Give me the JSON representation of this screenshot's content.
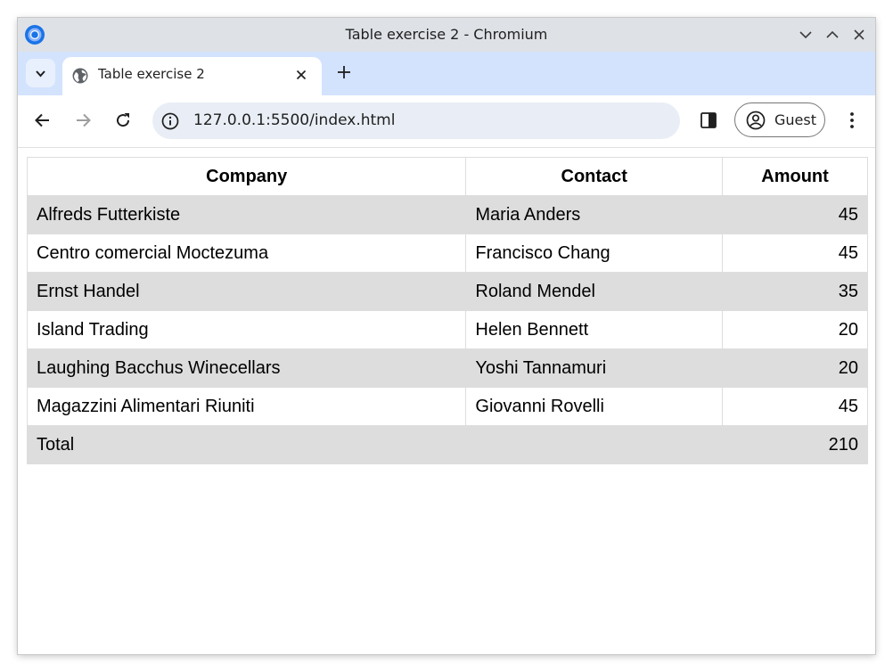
{
  "window": {
    "title": "Table exercise 2 - Chromium"
  },
  "tab": {
    "title": "Table exercise 2"
  },
  "omnibox": {
    "url": "127.0.0.1:5500/index.html"
  },
  "profile": {
    "label": "Guest"
  },
  "icons": {
    "app": "chromium-icon",
    "tab_search": "chevron-down-icon",
    "favicon": "globe-icon",
    "close_tab": "close-icon",
    "new_tab": "plus-icon",
    "back": "arrow-left-icon",
    "forward": "arrow-right-icon",
    "reload": "reload-icon",
    "site_info": "info-icon",
    "side_panel": "side-panel-icon",
    "profile": "account-circle-icon",
    "menu": "more-vert-icon"
  },
  "colors": {
    "titlebar": "#dee1e6",
    "tabstrip": "#d3e3fd",
    "omnibox": "#e9eef6",
    "row_stripe": "#dddddd"
  },
  "table": {
    "headers": [
      "Company",
      "Contact",
      "Amount"
    ],
    "rows": [
      [
        "Alfreds Futterkiste",
        "Maria Anders",
        "45"
      ],
      [
        "Centro comercial Moctezuma",
        "Francisco Chang",
        "45"
      ],
      [
        "Ernst Handel",
        "Roland Mendel",
        "35"
      ],
      [
        "Island Trading",
        "Helen Bennett",
        "20"
      ],
      [
        "Laughing Bacchus Winecellars",
        "Yoshi Tannamuri",
        "20"
      ],
      [
        "Magazzini Alimentari Riuniti",
        "Giovanni Rovelli",
        "45"
      ]
    ],
    "footer": {
      "label": "Total",
      "amount": "210"
    }
  }
}
